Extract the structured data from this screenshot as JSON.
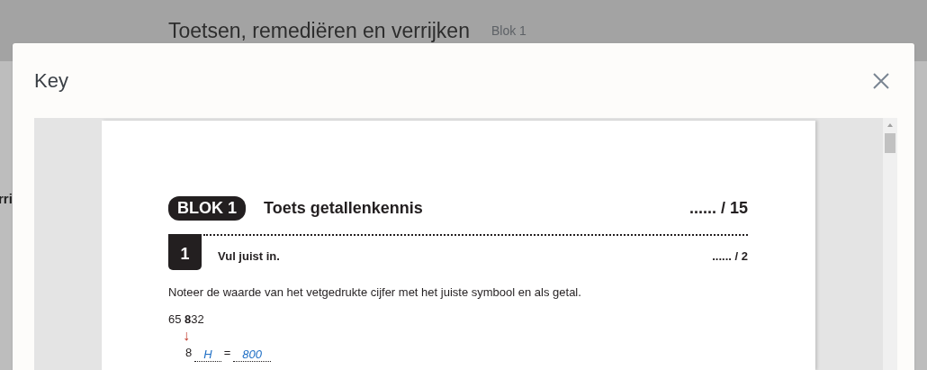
{
  "background": {
    "title": "Toetsen, remediëren en verrijken",
    "subtitle": "Blok 1",
    "side_text": "rri"
  },
  "dialog": {
    "title": "Key"
  },
  "document": {
    "badge": "BLOK 1",
    "title": "Toets getallenkennis",
    "score": "...... / 15",
    "exercises": [
      {
        "number": "1",
        "instruction": "Vul juist in.",
        "score": "...... / 2",
        "text": "Noteer de waarde van het vetgedrukte cijfer met het juiste symbool en als getal.",
        "given": "65 **8**32",
        "arrow": "↓",
        "answer_parts": [
          {
            "kind": "text",
            "text": "8"
          },
          {
            "kind": "blank",
            "text": "H"
          },
          {
            "kind": "text",
            "text": "="
          },
          {
            "kind": "blank",
            "text": "800"
          }
        ]
      }
    ]
  }
}
